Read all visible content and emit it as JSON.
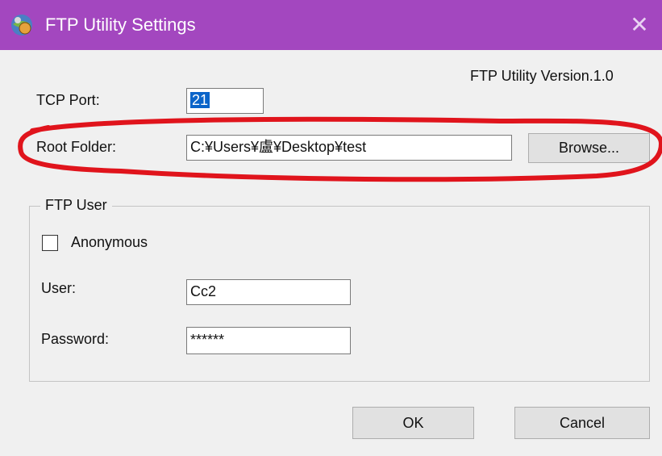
{
  "window": {
    "title": "FTP Utility Settings",
    "close_glyph": "✕",
    "app_icon": "ftp-utility-icon",
    "accent_color": "#a347bf"
  },
  "version_label": "FTP Utility Version.1.0",
  "tcp_port": {
    "label": "TCP Port:",
    "value": "21"
  },
  "root_folder": {
    "label": "Root Folder:",
    "value": "C:¥Users¥盧¥Desktop¥test",
    "browse_label": "Browse..."
  },
  "ftp_user": {
    "legend": "FTP User",
    "anonymous_label": "Anonymous",
    "anonymous_checked": false,
    "user_label": "User:",
    "user_value": "Cc2",
    "password_label": "Password:",
    "password_value": "******"
  },
  "buttons": {
    "ok": "OK",
    "cancel": "Cancel"
  },
  "annotation": {
    "color": "#e0141c",
    "shape": "hand-drawn-ellipse"
  }
}
